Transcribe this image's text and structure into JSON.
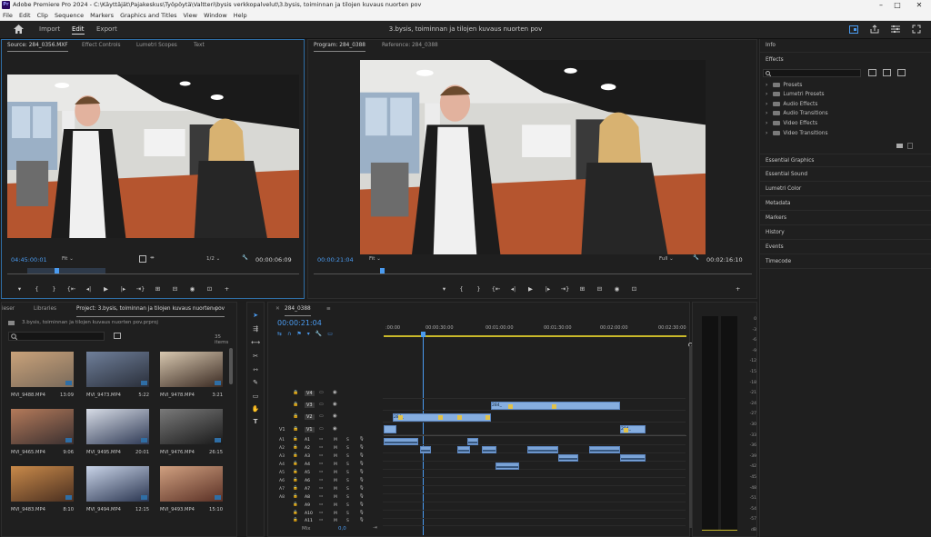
{
  "titlebar": {
    "title": "Adobe Premiere Pro 2024 - C:\\Käyttäjät\\Pajakeskus\\Työpöytä\\Valtteri\\bysis verkkopalvelut\\3.bysis, toiminnan ja tilojen kuvaus nuorten pov",
    "app_icon": "Pr",
    "minimize": "–",
    "maximize": "□",
    "close": "✕"
  },
  "menu": [
    "File",
    "Edit",
    "Clip",
    "Sequence",
    "Markers",
    "Graphics and Titles",
    "View",
    "Window",
    "Help"
  ],
  "workspace": {
    "home_icon": "home-icon",
    "tabs": [
      "Import",
      "Edit",
      "Export"
    ],
    "active": "Edit",
    "document_title": "3.bysis, toiminnan ja tilojen kuvaus nuorten pov"
  },
  "source": {
    "tabs": [
      "Source: 284_0356.MXF",
      "Effect Controls",
      "Lumetri Scopes",
      "Text"
    ],
    "timecode": "04:45:00:01",
    "fit": "Fit",
    "resolution": "1/2",
    "duration": "00:00:06:09",
    "controls": [
      "▾",
      "{",
      "}",
      "{⇤",
      "◂|",
      "▶",
      "|▸",
      "⇥}",
      "⊞",
      "⊟",
      "◉",
      "⊡",
      "+"
    ]
  },
  "program": {
    "tabs": [
      "Program: 284_0388",
      "Reference: 284_0388"
    ],
    "timecode": "00:00:21:04",
    "fit": "Fit",
    "resolution": "Full",
    "duration": "00:02:16:10",
    "controls": [
      "▾",
      "{",
      "}",
      "{⇤",
      "◂|",
      "▶",
      "|▸",
      "⇥}",
      "⊞",
      "⊟",
      "◉",
      "⊡",
      "+"
    ]
  },
  "right_panel": {
    "info": "Info",
    "effects_title": "Effects",
    "effects_tree": [
      "Presets",
      "Lumetri Presets",
      "Audio Effects",
      "Audio Transitions",
      "Video Effects",
      "Video Transitions"
    ],
    "sections": [
      "Essential Graphics",
      "Essential Sound",
      "Lumetri Color",
      "Metadata",
      "Markers",
      "History",
      "Events",
      "Timecode"
    ]
  },
  "project": {
    "tabs": [
      "ieser",
      "Libraries",
      "Project: 3.bysis, toiminnan ja tilojen kuvaus nuorten pov"
    ],
    "file": "3.bysis, toiminnan ja tilojen kuvaus nuorten pov.prproj",
    "search_placeholder": "",
    "items_count": "35 items",
    "clips": [
      {
        "name": "MVI_9488.MP4",
        "dur": "13:09"
      },
      {
        "name": "MVI_9473.MP4",
        "dur": "5:22"
      },
      {
        "name": "MVI_9478.MP4",
        "dur": "3:21"
      },
      {
        "name": "MVI_9465.MP4",
        "dur": "9:06"
      },
      {
        "name": "MVI_9495.MP4",
        "dur": "20:01"
      },
      {
        "name": "MVI_9476.MP4",
        "dur": "26:15"
      },
      {
        "name": "MVI_9483.MP4",
        "dur": "8:10"
      },
      {
        "name": "MVI_9494.MP4",
        "dur": "12:15"
      },
      {
        "name": "MVI_9493.MP4",
        "dur": "15:10"
      }
    ]
  },
  "timeline": {
    "tab": "284_0388",
    "timecode": "00:00:21:04",
    "ruler": [
      ":00:00",
      "00:00:30:00",
      "00:01:00:00",
      "00:01:30:00",
      "00:02:00:00",
      "00:02:30:00"
    ],
    "video_tracks": [
      "V4",
      "V3",
      "V2",
      "V1"
    ],
    "audio_tracks": [
      "A1",
      "A2",
      "A3",
      "A4",
      "A5",
      "A6",
      "A7",
      "A8",
      "A9",
      "A10",
      "A11"
    ],
    "mix_label": "Mix",
    "mix_value": "0,0",
    "clip_label": "284_"
  },
  "meter_scale": [
    "0",
    "-3",
    "-6",
    "-9",
    "-12",
    "-15",
    "-18",
    "-21",
    "-24",
    "-27",
    "-30",
    "-33",
    "-36",
    "-39",
    "-42",
    "-45",
    "-48",
    "-51",
    "-54",
    "-57",
    "dB"
  ]
}
